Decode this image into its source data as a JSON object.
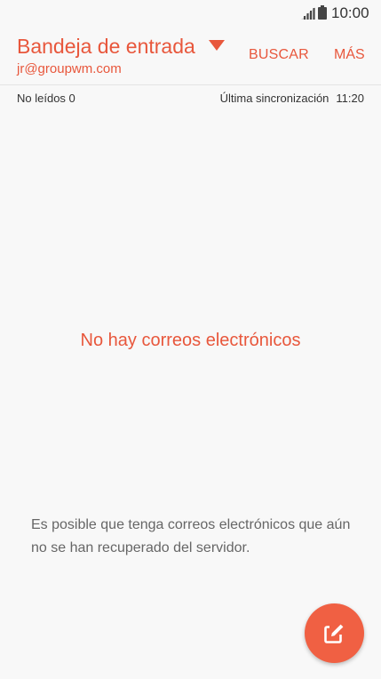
{
  "status_bar": {
    "time": "10:00",
    "signal_icon": "signal-bars-icon",
    "battery_icon": "battery-icon"
  },
  "header": {
    "folder_title": "Bandeja de entrada",
    "dropdown_icon": "triangle-down-icon",
    "account_email": "jr@groupwm.com",
    "search_label": "BUSCAR",
    "more_label": "MÁS"
  },
  "info_row": {
    "unread": "No leídos 0",
    "last_sync_label": "Última sincronización",
    "last_sync_time": "11:20"
  },
  "main": {
    "empty_message": "No hay correos electrónicos",
    "server_note": "Es posible que tenga correos electrónicos que aún no se han recuperado del servidor."
  },
  "fab": {
    "icon": "compose-icon"
  },
  "colors": {
    "accent": "#e8573c",
    "fab": "#f06043",
    "background": "#f8f8f8",
    "text": "#333333",
    "note_text": "#666666"
  }
}
